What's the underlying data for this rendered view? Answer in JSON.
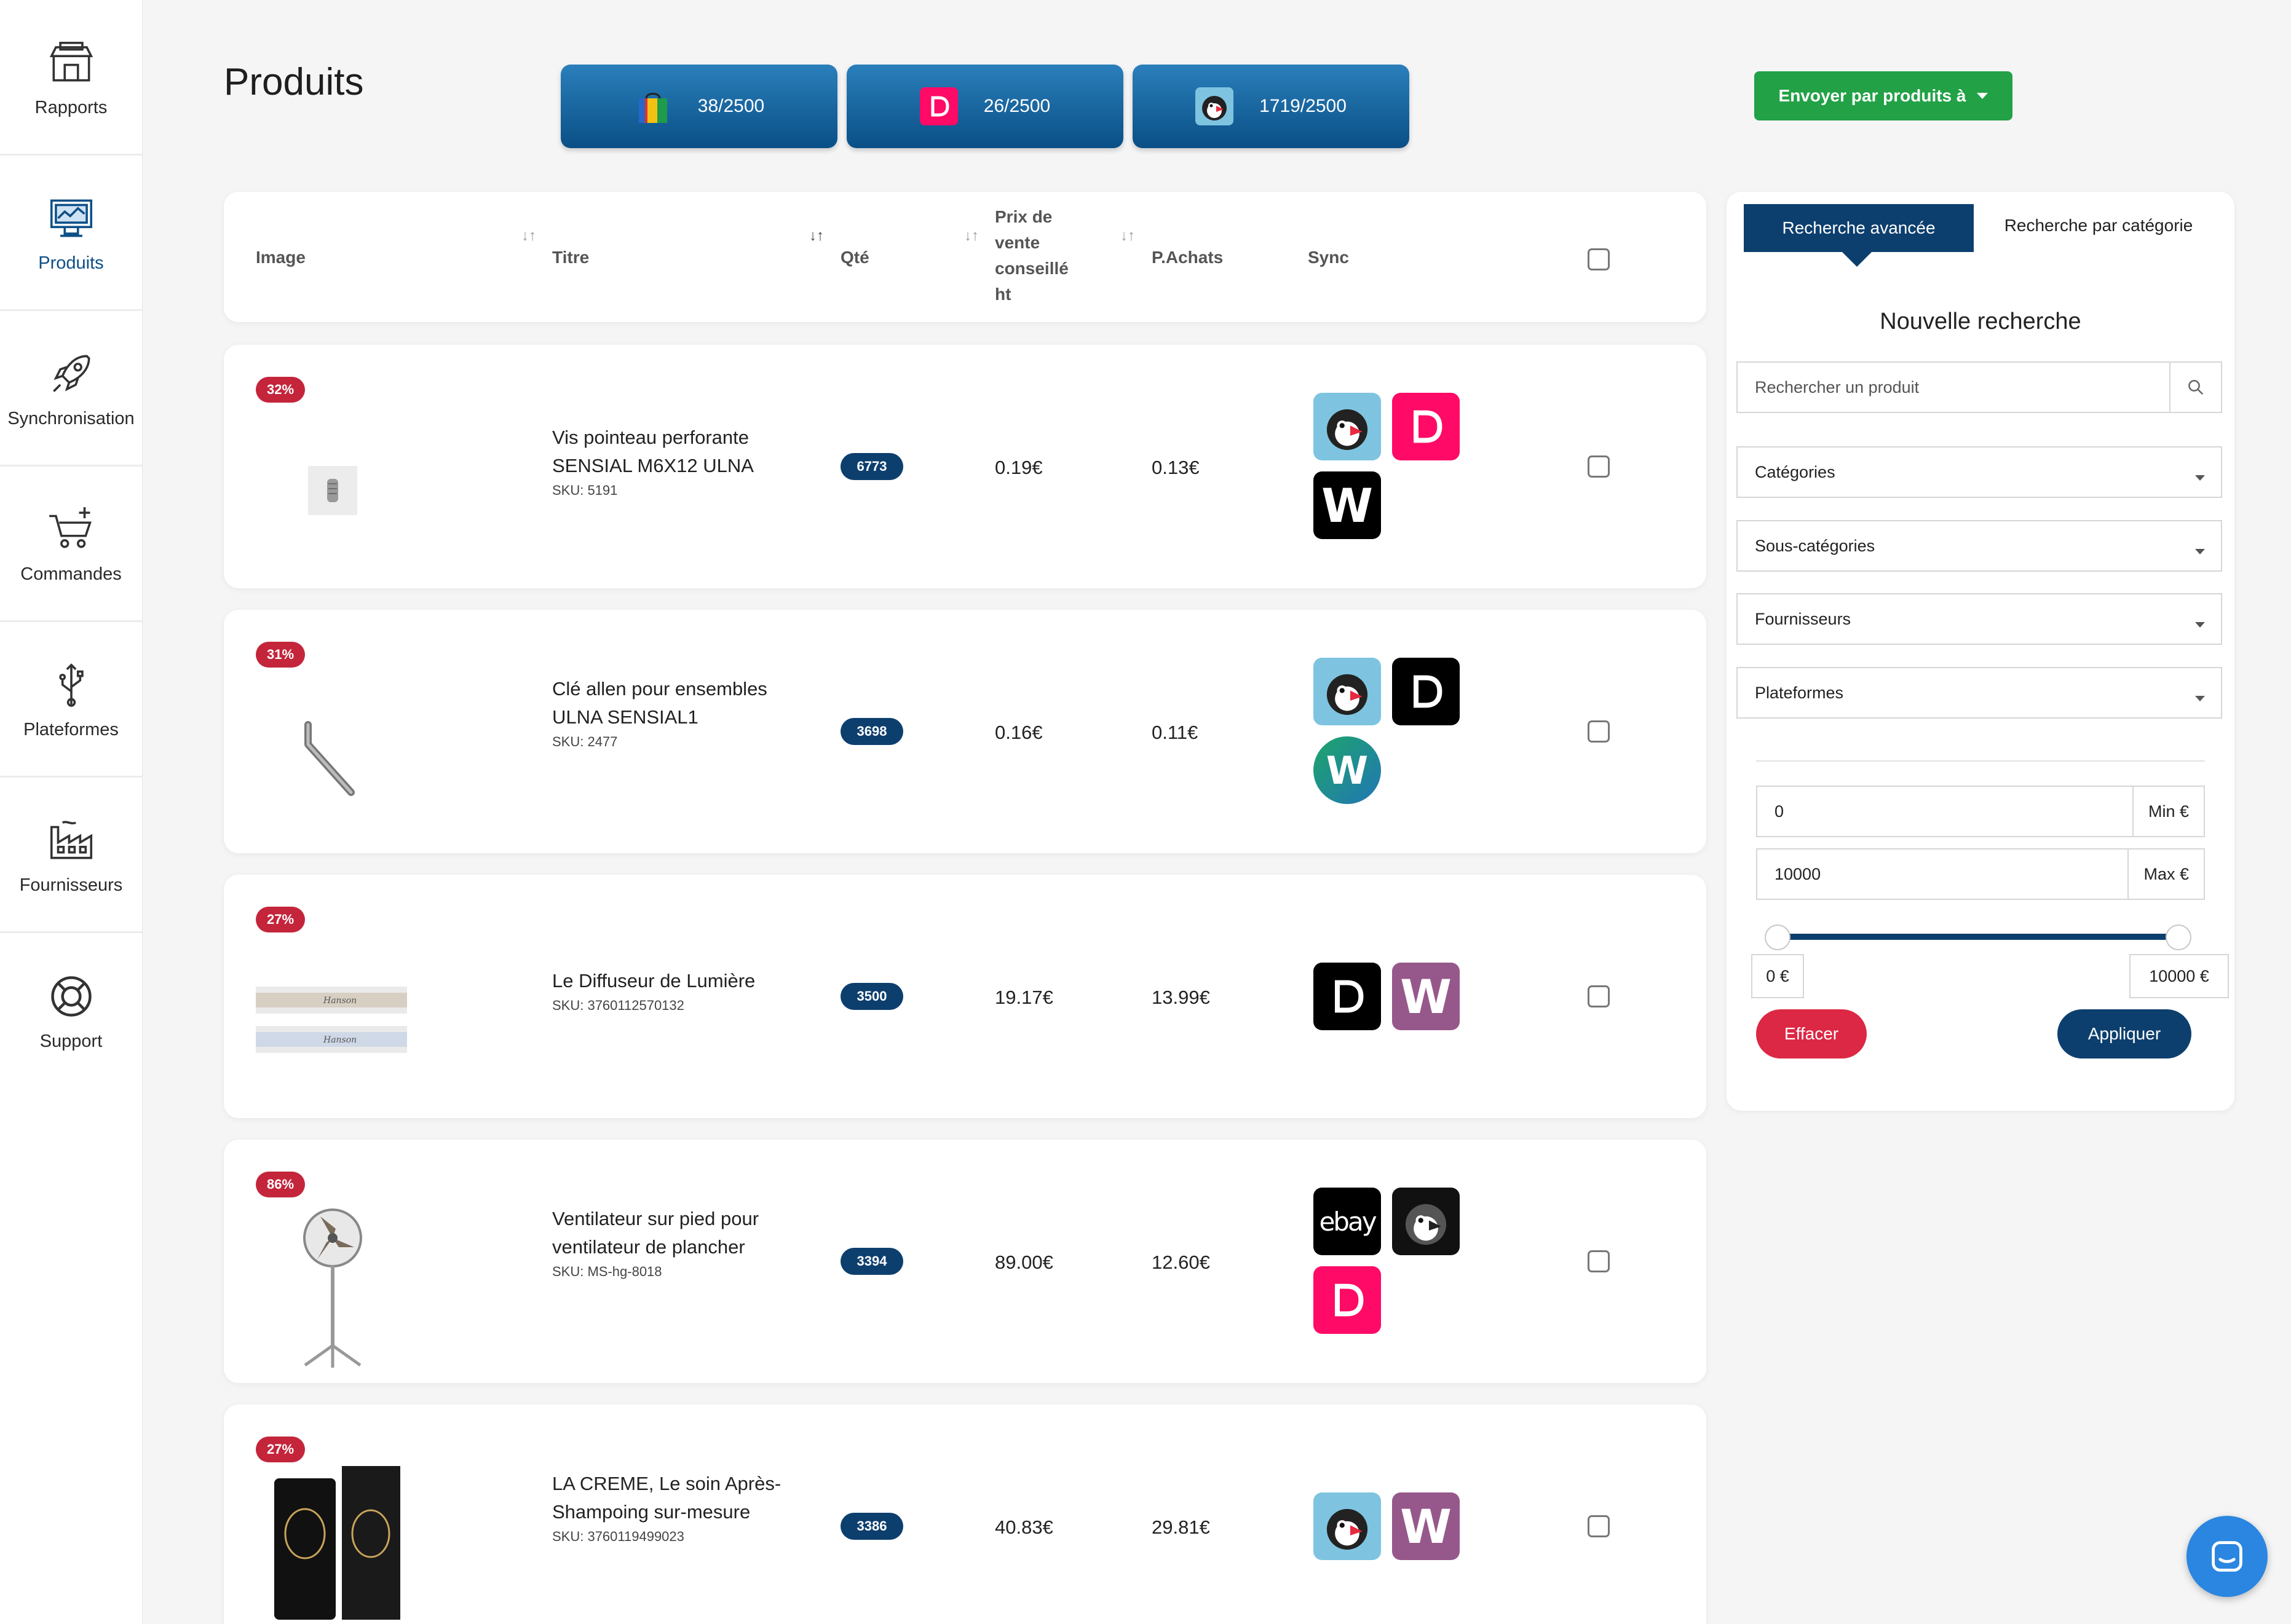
{
  "sidebar": {
    "items": [
      {
        "label": "Rapports",
        "icon": "store-icon"
      },
      {
        "label": "Produits",
        "icon": "monitor-icon",
        "active": true
      },
      {
        "label": "Synchronisation",
        "icon": "rocket-icon"
      },
      {
        "label": "Commandes",
        "icon": "cart-icon"
      },
      {
        "label": "Plateformes",
        "icon": "usb-icon"
      },
      {
        "label": "Fournisseurs",
        "icon": "factory-icon"
      },
      {
        "label": "Support",
        "icon": "lifebuoy-icon"
      }
    ]
  },
  "header": {
    "title": "Produits",
    "quotas": [
      {
        "label": "38/2500",
        "icon": "shopping-bag-icon"
      },
      {
        "label": "26/2500",
        "icon": "dolibarr-icon"
      },
      {
        "label": "1719/2500",
        "icon": "prestashop-icon"
      }
    ],
    "send_button": "Envoyer par produits à"
  },
  "table": {
    "columns": {
      "image": "Image",
      "title": "Titre",
      "qty": "Qté",
      "price": "Prix de vente conseillé ht",
      "price_lines": [
        "Prix de",
        "vente",
        "conseillé",
        "ht"
      ],
      "purchase": "P.Achats",
      "sync": "Sync"
    },
    "rows": [
      {
        "badge": "32%",
        "title": "Vis pointeau perforante SENSIAL M6X12 ULNA",
        "sku": "SKU: 5191",
        "qty": "6773",
        "price": "0.19€",
        "purchase": "0.13€",
        "sync": [
          "prestashop",
          "dolibarr",
          "wix"
        ]
      },
      {
        "badge": "31%",
        "title": "Clé allen pour ensembles ULNA SENSIAL1",
        "sku": "SKU: 2477",
        "qty": "3698",
        "price": "0.16€",
        "purchase": "0.11€",
        "sync": [
          "prestashop",
          "dolibarr-black",
          "wix-round"
        ]
      },
      {
        "badge": "27%",
        "title": "Le Diffuseur de Lumière",
        "sku": "SKU: 3760112570132",
        "qty": "3500",
        "price": "19.17€",
        "purchase": "13.99€",
        "sync": [
          "dolibarr-black",
          "woocommerce"
        ]
      },
      {
        "badge": "86%",
        "title": "Ventilateur sur pied pour ventilateur de plancher",
        "sku": "SKU: MS-hg-8018",
        "qty": "3394",
        "price": "89.00€",
        "purchase": "12.60€",
        "sync": [
          "ebay",
          "prestashop-dark",
          "dolibarr"
        ]
      },
      {
        "badge": "27%",
        "title": "LA CREME, Le soin Après-Shampoing sur-mesure",
        "sku": "SKU: 3760119499023",
        "qty": "3386",
        "price": "40.83€",
        "purchase": "29.81€",
        "sync": [
          "prestashop",
          "woocommerce"
        ]
      }
    ]
  },
  "panel": {
    "tab_advanced": "Recherche avancée",
    "tab_category": "Recherche par catégorie",
    "heading": "Nouvelle recherche",
    "search_placeholder": "Rechercher un produit",
    "selects": [
      "Catégories",
      "Sous-catégories",
      "Fournisseurs",
      "Plateformes"
    ],
    "min_value": "0",
    "min_unit": "Min €",
    "max_value": "10000",
    "max_unit": "Max €",
    "range_low": "0 €",
    "range_high": "10000 €",
    "clear": "Effacer",
    "apply": "Appliquer"
  },
  "colors": {
    "primary": "#0d3f6e",
    "success": "#22a146",
    "danger": "#dc2844",
    "badge": "#c4253b"
  }
}
